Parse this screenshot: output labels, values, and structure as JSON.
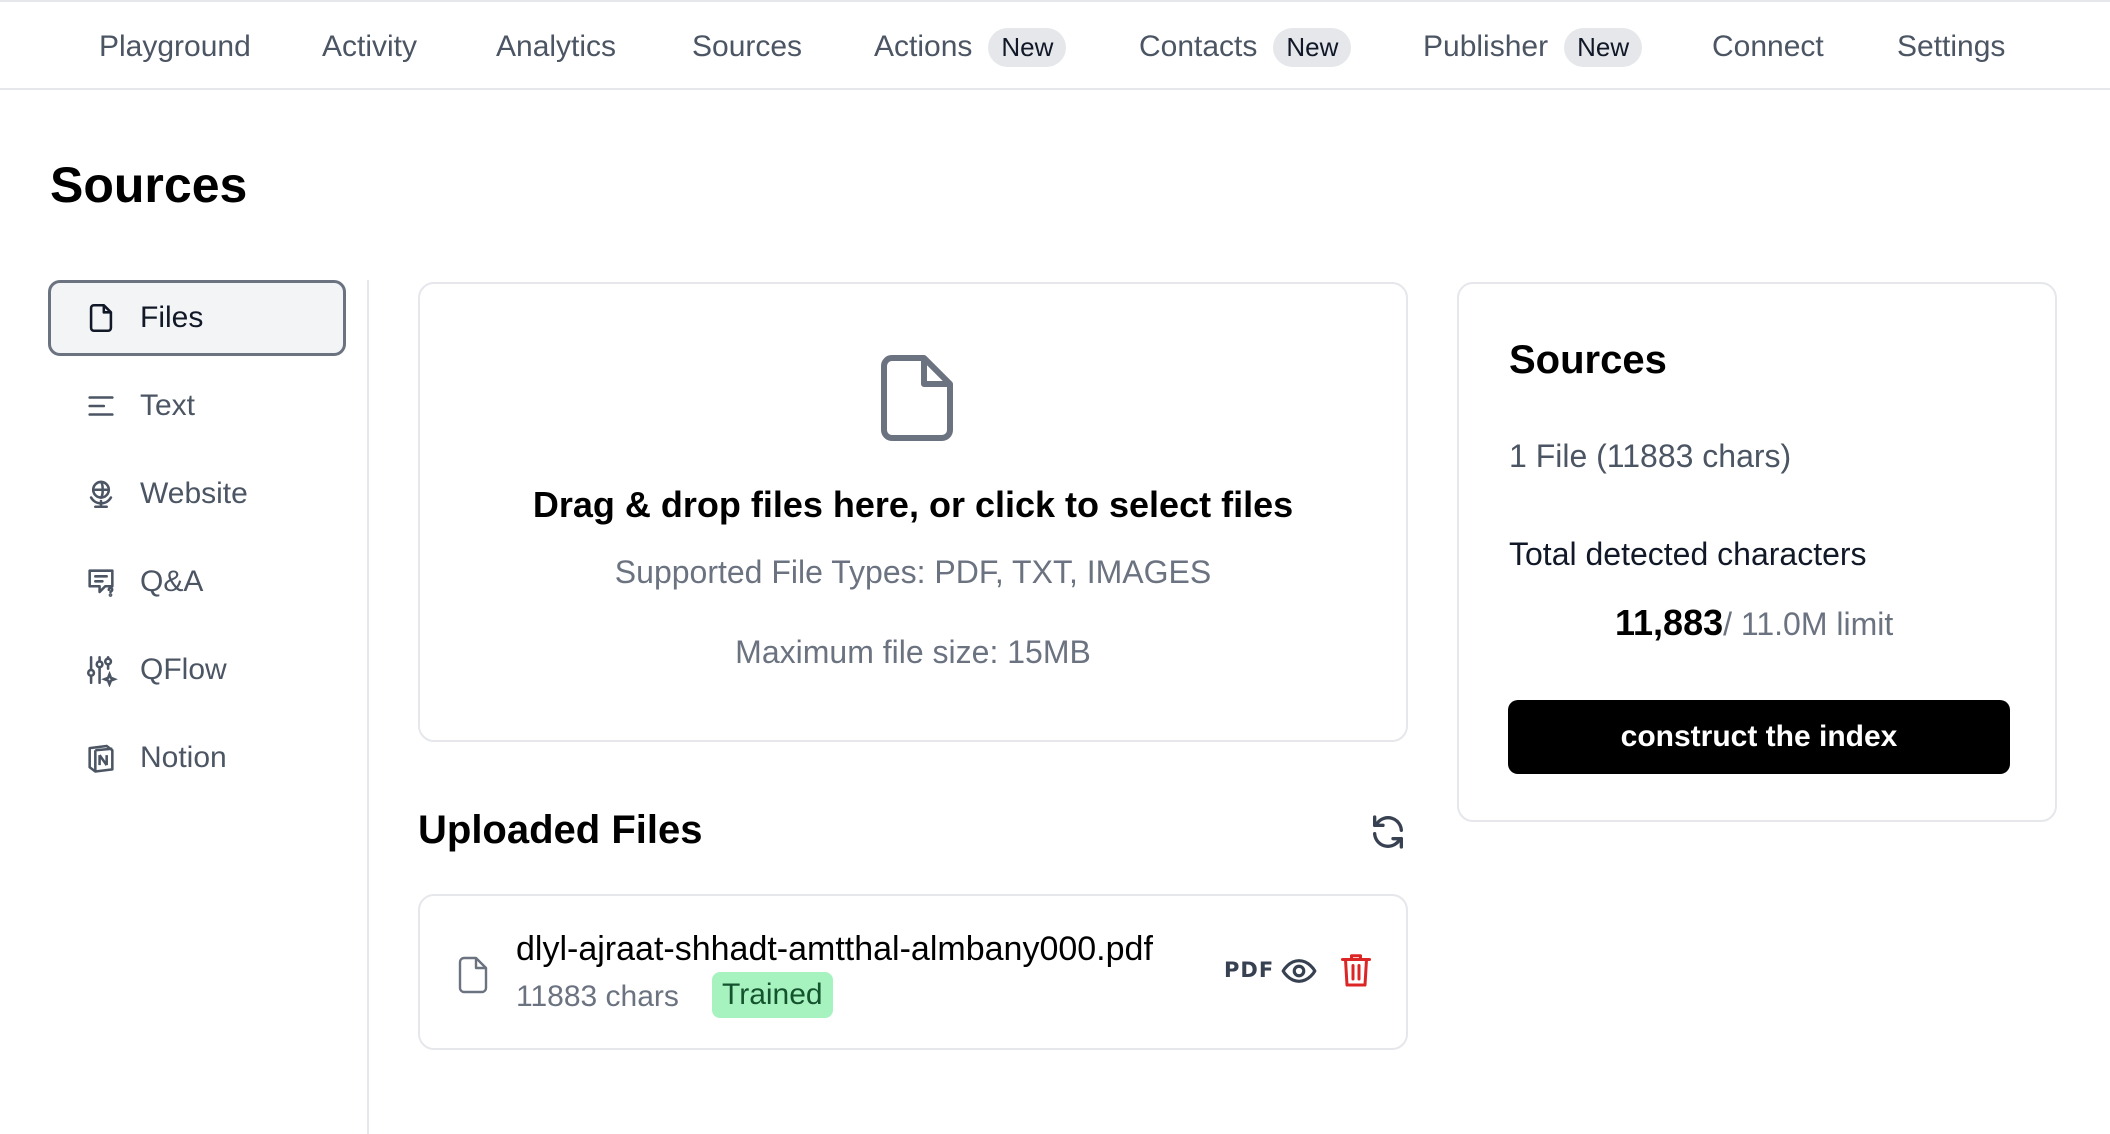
{
  "nav": {
    "items": [
      {
        "label": "Playground",
        "badge": ""
      },
      {
        "label": "Activity",
        "badge": ""
      },
      {
        "label": "Analytics",
        "badge": ""
      },
      {
        "label": "Sources",
        "badge": ""
      },
      {
        "label": "Actions",
        "badge": "New"
      },
      {
        "label": "Contacts",
        "badge": "New"
      },
      {
        "label": "Publisher",
        "badge": "New"
      },
      {
        "label": "Connect",
        "badge": ""
      },
      {
        "label": "Settings",
        "badge": ""
      }
    ]
  },
  "page": {
    "title": "Sources"
  },
  "sidebar": {
    "items": [
      {
        "label": "Files",
        "icon": "file-icon",
        "active": true
      },
      {
        "label": "Text",
        "icon": "text-lines-icon",
        "active": false
      },
      {
        "label": "Website",
        "icon": "globe-icon",
        "active": false
      },
      {
        "label": "Q&A",
        "icon": "chat-question-icon",
        "active": false
      },
      {
        "label": "QFlow",
        "icon": "sliders-sparkle-icon",
        "active": false
      },
      {
        "label": "Notion",
        "icon": "notion-icon",
        "active": false
      }
    ]
  },
  "dropzone": {
    "icon": "file-icon",
    "title": "Drag & drop files here, or click to select files",
    "supported": "Supported File Types: PDF, TXT, IMAGES",
    "max_size": "Maximum file size: 15MB"
  },
  "uploaded": {
    "title": "Uploaded Files",
    "refresh_icon": "refresh-icon",
    "files": [
      {
        "name": "dlyl-ajraat-shhadt-amtthal-almbany000.pdf",
        "chars": "11883 chars",
        "status": "Trained",
        "type_tag": "PDF"
      }
    ]
  },
  "summary": {
    "title": "Sources",
    "files_line": "1 File (11883 chars)",
    "total_label": "Total detected characters",
    "count": "11,883",
    "limit": "/ 11.0M limit",
    "button": "construct the index"
  },
  "colors": {
    "accent_button": "#000000",
    "trained_badge": "#a7f3c0",
    "delete_icon": "#dc2626",
    "border": "#e5e7eb"
  }
}
